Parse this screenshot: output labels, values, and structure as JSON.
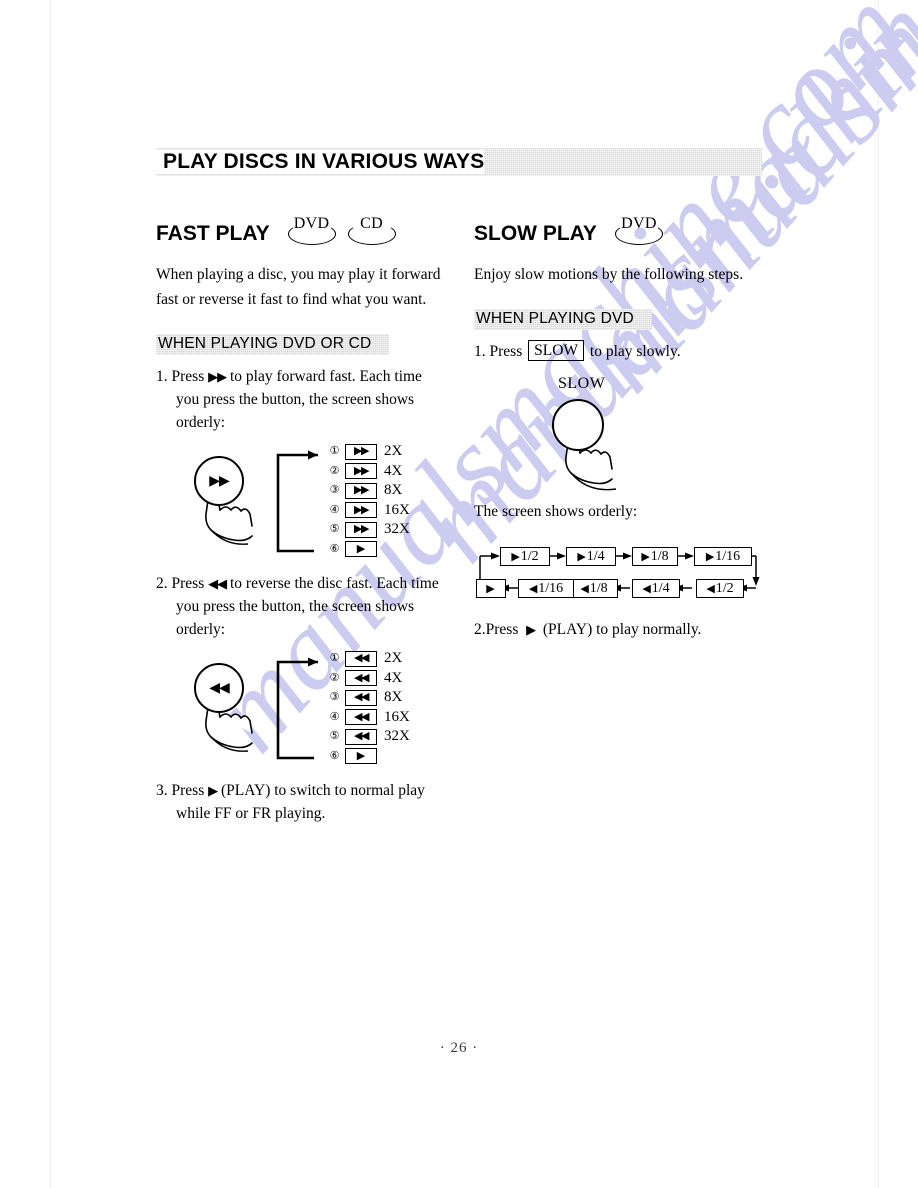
{
  "document": {
    "section_title": "PLAY DISCS IN VARIOUS WAYS",
    "page_number": "· 26 ·",
    "watermark_text": "manualsmachine.com",
    "watermark_color": "#ccccf0"
  },
  "left_column": {
    "heading": "FAST PLAY",
    "badges": [
      {
        "label": "DVD",
        "name": "dvd-badge"
      },
      {
        "label": "CD",
        "name": "cd-badge"
      }
    ],
    "intro": "When playing a disc, you may play it forward fast or reverse it fast to find what you want.",
    "subhead": "WHEN PLAYING DVD OR CD",
    "step1": "1. Press ▶▶ to play forward fast. Each time you press the button, the screen shows orderly:",
    "step1_prefix": "1. Press",
    "step1_glyph": "▶▶",
    "step1_rest": "to play forward fast. Each time you press the button, the screen shows orderly:",
    "step2_prefix": "2. Press",
    "step2_glyph": "◀◀",
    "step2_rest": "to reverse the disc fast. Each time you press the button, the screen shows orderly:",
    "step3_prefix": "3. Press",
    "step3_glyph": "▶",
    "step3_rest": "(PLAY) to switch to normal play while FF or FR playing.",
    "forward_diagram": {
      "button_icon": "▶▶",
      "rows": [
        {
          "num": "①",
          "icon": "▶▶",
          "speed": "2X"
        },
        {
          "num": "②",
          "icon": "▶▶",
          "speed": "4X"
        },
        {
          "num": "③",
          "icon": "▶▶",
          "speed": "8X"
        },
        {
          "num": "④",
          "icon": "▶▶",
          "speed": "16X"
        },
        {
          "num": "⑤",
          "icon": "▶▶",
          "speed": "32X"
        },
        {
          "num": "⑥",
          "icon": "▶",
          "speed": ""
        }
      ]
    },
    "reverse_diagram": {
      "button_icon": "◀◀",
      "rows": [
        {
          "num": "①",
          "icon": "◀◀",
          "speed": "2X"
        },
        {
          "num": "②",
          "icon": "◀◀",
          "speed": "4X"
        },
        {
          "num": "③",
          "icon": "◀◀",
          "speed": "8X"
        },
        {
          "num": "④",
          "icon": "◀◀",
          "speed": "16X"
        },
        {
          "num": "⑤",
          "icon": "◀◀",
          "speed": "32X"
        },
        {
          "num": "⑥",
          "icon": "▶",
          "speed": ""
        }
      ]
    }
  },
  "right_column": {
    "heading": "SLOW PLAY",
    "badges": [
      {
        "label": "DVD",
        "name": "dvd-badge"
      }
    ],
    "intro": "Enjoy slow motions by the following steps.",
    "subhead": "WHEN PLAYING  DVD",
    "step1_prefix": "1. Press",
    "step1_key": "SLOW",
    "step1_rest": "to play slowly.",
    "slow_button_label": "SLOW",
    "screen_caption": "The screen shows orderly:",
    "step2_prefix": "2.Press",
    "step2_glyph": "▶",
    "step2_rest": "(PLAY) to play normally.",
    "slow_flow": {
      "top_row": [
        {
          "tri": "▶",
          "label": "1/2"
        },
        {
          "tri": "▶",
          "label": "1/4"
        },
        {
          "tri": "▶",
          "label": "1/8"
        },
        {
          "tri": "▶",
          "label": "1/16"
        }
      ],
      "bottom_row": [
        {
          "tri": "▶",
          "label": ""
        },
        {
          "tri": "◀",
          "label": "1/16"
        },
        {
          "tri": "◀",
          "label": "1/8"
        },
        {
          "tri": "◀",
          "label": "1/4"
        },
        {
          "tri": "◀",
          "label": "1/2"
        }
      ]
    }
  }
}
